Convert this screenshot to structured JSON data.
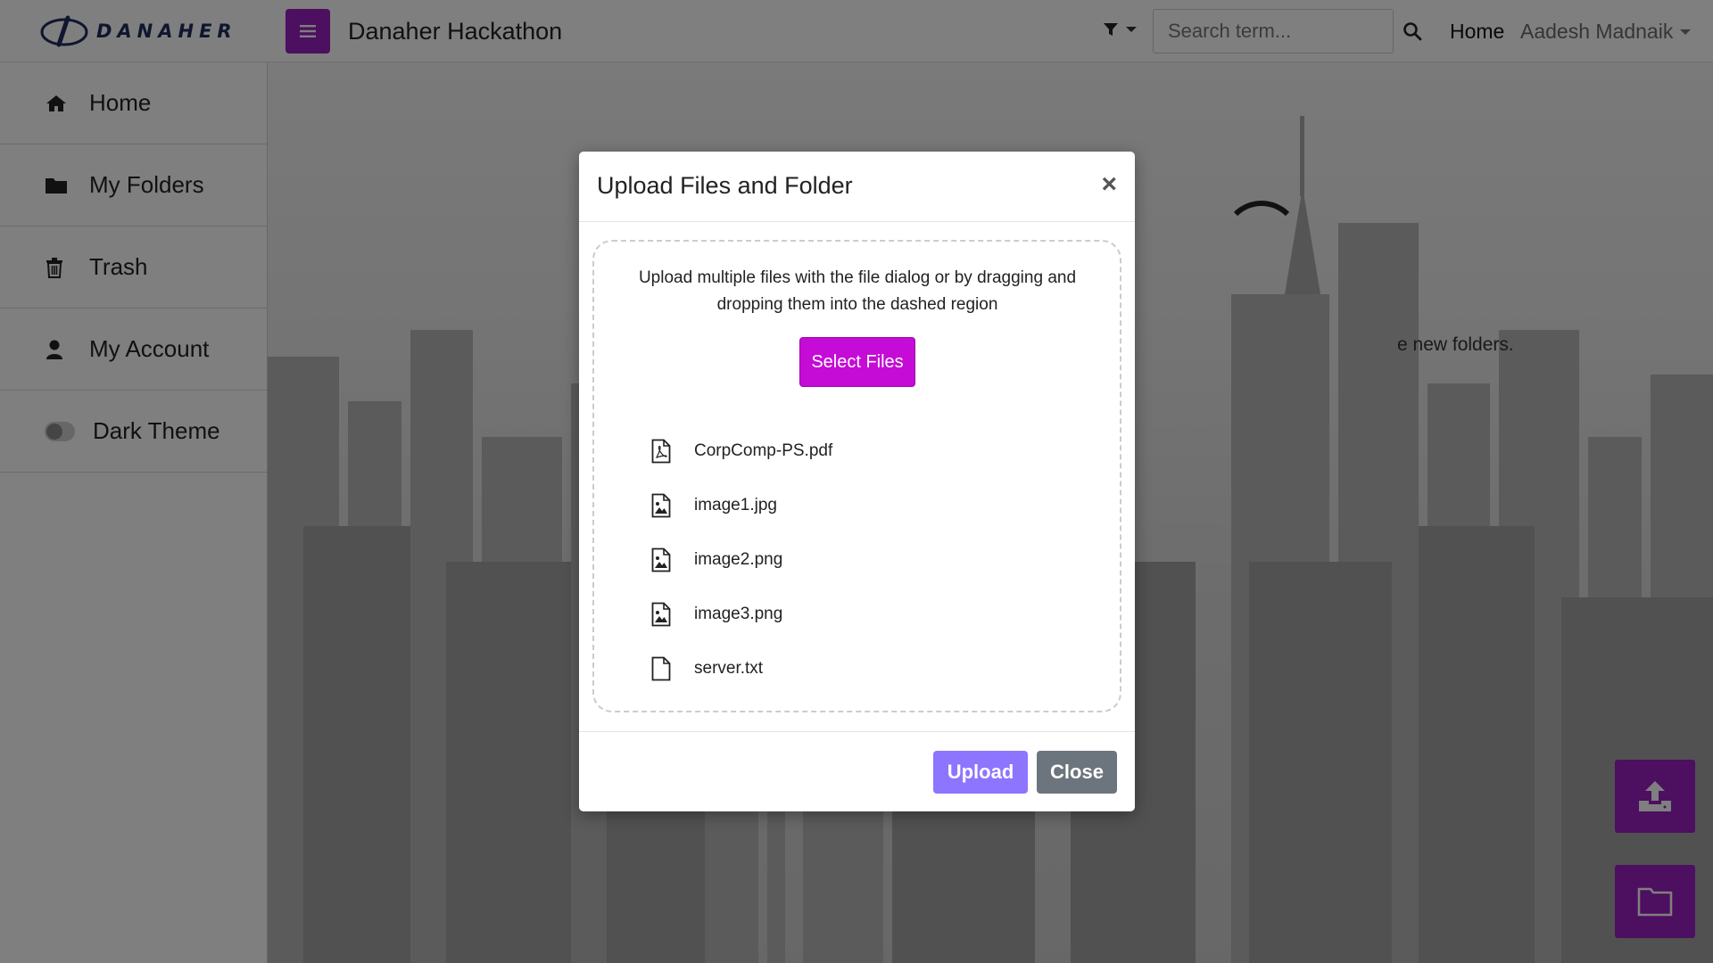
{
  "brand": {
    "logo_text": "DANAHER"
  },
  "header": {
    "title": "Danaher Hackathon",
    "search_placeholder": "Search term...",
    "home_link": "Home",
    "user_name": "Aadesh Madnaik"
  },
  "sidebar": {
    "items": [
      {
        "label": "Home",
        "icon": "home-icon"
      },
      {
        "label": "My Folders",
        "icon": "folder-icon"
      },
      {
        "label": "Trash",
        "icon": "trash-icon"
      },
      {
        "label": "My Account",
        "icon": "user-icon"
      },
      {
        "label": "Dark Theme",
        "icon": "toggle-switch"
      }
    ]
  },
  "background": {
    "partial_text": "e new folders."
  },
  "modal": {
    "title": "Upload Files and Folder",
    "description": "Upload multiple files with the file dialog or by dragging and dropping them into the dashed region",
    "select_button": "Select Files",
    "files": [
      {
        "name": "CorpComp-PS.pdf",
        "icon": "pdf-file-icon"
      },
      {
        "name": "image1.jpg",
        "icon": "image-file-icon"
      },
      {
        "name": "image2.png",
        "icon": "image-file-icon"
      },
      {
        "name": "image3.png",
        "icon": "image-file-icon"
      },
      {
        "name": "server.txt",
        "icon": "text-file-icon"
      }
    ],
    "upload_button": "Upload",
    "close_button": "Close"
  },
  "colors": {
    "primary_purple": "#9b1fbe",
    "select_button": "#c50bd6",
    "upload_button": "#8d75ff",
    "close_button": "#6c757d"
  }
}
